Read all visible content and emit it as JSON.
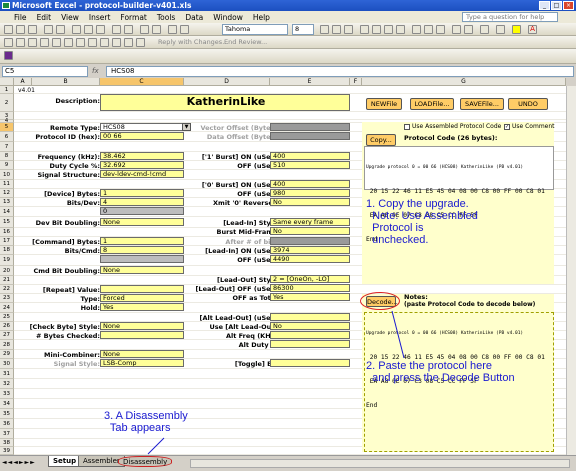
{
  "window": {
    "title": "Microsoft Excel - protocol-builder-v401.xls",
    "min": "_",
    "max": "□",
    "close": "×"
  },
  "menu": {
    "items": [
      "File",
      "Edit",
      "View",
      "Insert",
      "Format",
      "Tools",
      "Data",
      "Window",
      "Help"
    ],
    "help_placeholder": "Type a question for help"
  },
  "toolbar": {
    "font": "Tahoma",
    "size": "8",
    "reply": "Reply with Changes...",
    "end_review": "End Review..."
  },
  "formula_bar": {
    "name_box": "C5",
    "fx": "fx",
    "content": "HCS08"
  },
  "columns": [
    "A",
    "B",
    "C",
    "D",
    "E",
    "F",
    "G"
  ],
  "rows": [
    "1",
    "2",
    "3",
    "4",
    "5",
    "6",
    "7",
    "8",
    "9",
    "10",
    "11",
    "12",
    "13",
    "14",
    "15",
    "16",
    "17",
    "18",
    "19",
    "20",
    "21",
    "22",
    "23",
    "24",
    "25",
    "26",
    "27",
    "28",
    "29",
    "30",
    "31",
    "32",
    "33",
    "34",
    "35",
    "36",
    "37",
    "38",
    "39"
  ],
  "sheet": {
    "version": "v4.01",
    "description_label": "Description:",
    "description": "KatherinLike",
    "remote_type_label": "Remote Type:",
    "remote_type": "HCS08",
    "protocol_id_label": "Protocol ID (hex):",
    "protocol_id": "00 66",
    "vector_offset_label": "Vector Offset (Bytes):",
    "data_offset_label": "Data Offset (Bytes):",
    "frequency_label": "Frequency (kHz):",
    "frequency": "38.462",
    "duty_label": "Duty Cycle %:",
    "duty": "32.692",
    "signal_label": "Signal Structure:",
    "signal": "dev-ldev-cmd-!cmd",
    "device_bytes_label": "[Device] Bytes:",
    "device_bytes": "1",
    "bits_dev_label": "Bits/Dev:",
    "bits_dev": "4",
    "device_val": "0",
    "dev_doubling_label": "Dev Bit Doubling:",
    "dev_doubling": "None",
    "command_bytes_label": "[Command] Bytes:",
    "command_bytes": "1",
    "bits_cmd_label": "Bits/Cmd:",
    "bits_cmd": "8",
    "cmd_doubling_label": "Cmd Bit Doubling:",
    "cmd_doubling": "None",
    "repeat_value_label": "[Repeat] Value:",
    "repeat_value": "",
    "type_label": "Type:",
    "type": "Forced",
    "hold_label": "Hold:",
    "hold": "Yes",
    "check_byte_label": "[Check Byte] Style:",
    "check_byte": "None",
    "bytes_checked_label": "# Bytes Checked:",
    "bytes_checked": "",
    "mini_combiner_label": "Mini-Combiner:",
    "mini_combiner": "None",
    "signal_style_label": "Signal Style:",
    "signal_style": "LSB-Comp",
    "one_burst_on_label": "['1' Burst] ON (uSec):",
    "one_burst_on": "400",
    "one_burst_off_label": "OFF (uSec):",
    "one_burst_off": "510",
    "zero_burst_on_label": "['0' Burst] ON (uSec):",
    "zero_burst_on": "400",
    "zero_burst_off_label": "OFF (uSec):",
    "zero_burst_off": "980",
    "xmit_label": "Xmit '0' Reversed:",
    "xmit": "No",
    "lead_in_style_label": "[Lead-In] Style:",
    "lead_in_style": "Same every frame",
    "burst_mid_label": "Burst Mid-Frame:",
    "burst_mid": "No",
    "after_bits_label": "After # of bits:",
    "lead_in_on_label": "[Lead-In] ON (uSec):",
    "lead_in_on": "3974",
    "lead_in_off_label": "OFF (uSec):",
    "lead_in_off": "4490",
    "lead_out_label": "[Lead-Out] Style:",
    "lead_out": "2 = [OneOn, -LO]",
    "lead_out_off_label": "[Lead-Out] OFF (uSec):",
    "lead_out_off": "86300",
    "off_total_label": "OFF as Total:",
    "off_total": "Yes",
    "alt_lead_out_label": "[Alt Lead-Out] (uSec):",
    "alt_lead_out": "",
    "use_alt_label": "Use [Alt Lead-Out]:",
    "use_alt": "No",
    "alt_freq_label": "Alt Freq (KHz):",
    "alt_freq": "",
    "alt_duty_label": "Alt Duty %:",
    "alt_duty": "",
    "toggle_label": "[Toggle] Bit:",
    "toggle": "",
    "btn_new": "NEWFile",
    "btn_load": "LOADFile...",
    "btn_save": "SAVEFile...",
    "btn_undo": "UNDO",
    "btn_copy": "Copy...",
    "chk_assembled": "Use Assembled Protocol Code",
    "chk_comment": "Use Comment",
    "protocol_code_label": "Protocol Code (26 bytes):",
    "code_line1": "Upgrade protocol 0 = 00 66 (HCS08) KatherinLike (PB v4.01)",
    "code_line2": " 20 15 22 46 11 E5 45 04 08 00 C8 00 FF 00 C8 01",
    "code_line3": " EA A8 0E 07 C3 08 C5 CC FF 5F",
    "code_end": "End",
    "btn_decode": "Decode...",
    "notes_label": "Notes:",
    "notes_sub": "(paste Protocol Code to decode below)",
    "decode_line1": "Upgrade protocol 0 = 00 66 (HCS08) KatherinLike (PB v4.01)",
    "decode_line2": " 20 15 22 46 11 E5 45 04 08 00 C8 00 FF 00 C8 01",
    "decode_line3": " EA A8 0E 07 C3 08 C5 CC FF 5F",
    "decode_end": "End"
  },
  "annotations": {
    "note1": "1. Copy the upgrade.\n  Note: Use Assembled\n  Protocol is\n  unchecked.",
    "note2": "2. Paste the protocol here\n  and press the Decode Button",
    "note3": "3. A Disassembly\n  Tab appears"
  },
  "tabs": [
    "Setup",
    "Assembler",
    "Disassembly"
  ]
}
